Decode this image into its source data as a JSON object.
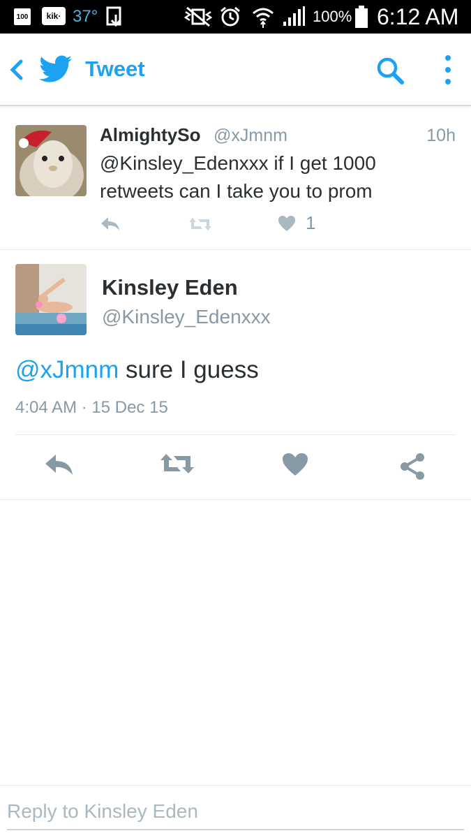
{
  "statusbar": {
    "badge": "100",
    "kik": "kik·",
    "temperature": "37°",
    "battery_percent": "100%",
    "time": "6:12 AM"
  },
  "appbar": {
    "title": "Tweet",
    "icons": [
      "back-chevron-icon",
      "twitter-bird-icon",
      "search-icon",
      "more-vertical-icon"
    ],
    "accent_color": "#1da1f2"
  },
  "parent_tweet": {
    "name": "AlmightySo",
    "handle": "@xJmnm",
    "time": "10h",
    "text": "@Kinsley_Edenxxx if I get 1000 retweets can I take you to prom",
    "like_count": "1"
  },
  "main_tweet": {
    "name": "Kinsley Eden",
    "handle": "@Kinsley_Edenxxx",
    "mention": "@xJmnm",
    "text": " sure I guess",
    "meta": "4:04 AM · 15 Dec 15"
  },
  "reply": {
    "placeholder": "Reply to Kinsley Eden"
  }
}
